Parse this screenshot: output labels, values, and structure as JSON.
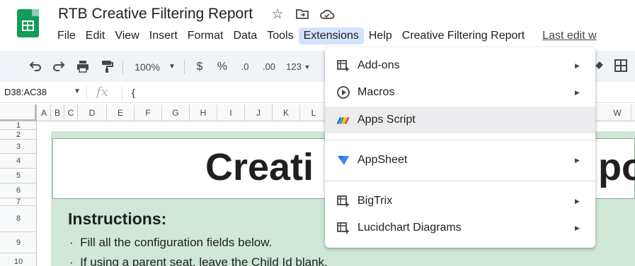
{
  "app": {
    "doc_title": "RTB Creative Filtering Report",
    "title_icons": [
      "star-icon",
      "move-to-folder-icon",
      "cloud-status-icon"
    ]
  },
  "menubar": {
    "items": [
      "File",
      "Edit",
      "View",
      "Insert",
      "Format",
      "Data",
      "Tools",
      "Extensions",
      "Help",
      "Creative Filtering Report"
    ],
    "active": "Extensions",
    "last_edit": "Last edit w"
  },
  "toolbar": {
    "zoom": "100%",
    "currency": "$",
    "percent": "%",
    "dec_decrease": ".0",
    "dec_increase": ".00",
    "more_formats": "123"
  },
  "formula_bar": {
    "namebox": "D38:AC38",
    "fx": "fx",
    "formula": "{"
  },
  "grid": {
    "columns": [
      "A",
      "B",
      "C",
      "D",
      "E",
      "F",
      "G",
      "H",
      "I",
      "J",
      "K",
      "L",
      "W"
    ],
    "rows": [
      "1",
      "2",
      "3",
      "4",
      "5",
      "6",
      "7",
      "8",
      "9",
      "10"
    ],
    "title_left": "Creati",
    "title_right": "po",
    "instructions_title": "Instructions:",
    "bullets": [
      "Fill all the configuration fields below.",
      "If using a parent seat, leave the Child Id blank."
    ]
  },
  "extensions_menu": {
    "items": [
      {
        "label": "Add-ons",
        "icon": "add-ons-icon",
        "submenu": true
      },
      {
        "label": "Macros",
        "icon": "macros-icon",
        "submenu": true
      },
      {
        "label": "Apps Script",
        "icon": "apps-script-icon",
        "submenu": false
      },
      {
        "label": "AppSheet",
        "icon": "appsheet-icon",
        "submenu": true
      },
      {
        "label": "BigTrix",
        "icon": "bigtrix-icon",
        "submenu": true
      },
      {
        "label": "Lucidchart Diagrams",
        "icon": "lucidchart-icon",
        "submenu": true
      }
    ],
    "hovered": "Apps Script"
  },
  "colors": {
    "brand_green": "#0f9d58",
    "active_menu": "#d3e3fd",
    "sheet_band": "#cfe8d8",
    "toolbar_bg": "#f0f4f9"
  }
}
